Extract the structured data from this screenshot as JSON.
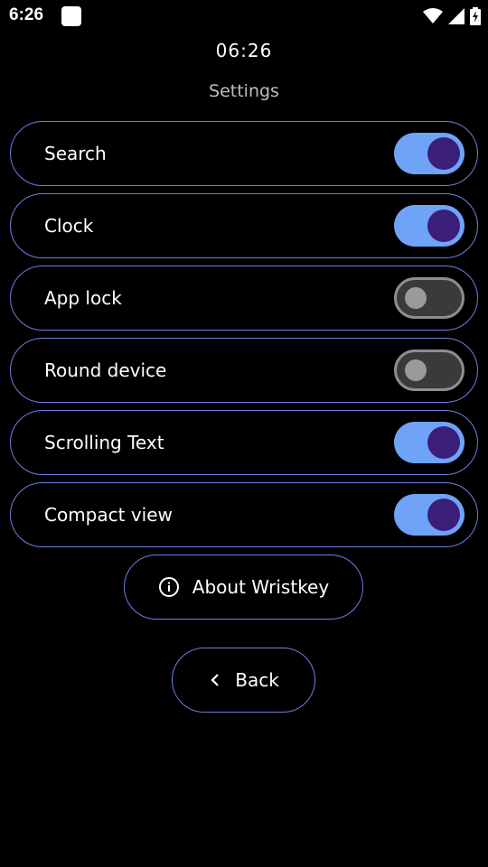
{
  "status_bar": {
    "time": "6:26"
  },
  "clock": "06:26",
  "title": "Settings",
  "settings": [
    {
      "label": "Search",
      "enabled": true
    },
    {
      "label": "Clock",
      "enabled": true
    },
    {
      "label": "App lock",
      "enabled": false
    },
    {
      "label": "Round device",
      "enabled": false
    },
    {
      "label": "Scrolling Text",
      "enabled": true
    },
    {
      "label": "Compact view",
      "enabled": true
    }
  ],
  "about_button": {
    "label": "About Wristkey",
    "icon": "info-icon"
  },
  "back_button": {
    "label": "Back",
    "icon": "chevron-left-icon"
  },
  "colors": {
    "accent_border": "#6f7de0",
    "toggle_on_track": "#6ea3f7",
    "toggle_on_knob": "#3b1e78"
  }
}
